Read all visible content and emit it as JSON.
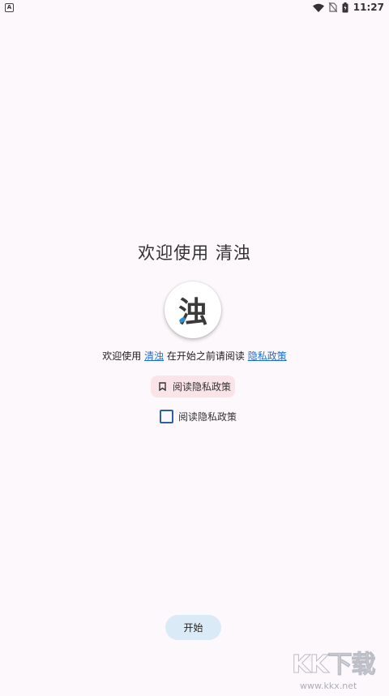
{
  "status_bar": {
    "notification_icon_letter": "A",
    "time": "11:27"
  },
  "welcome": {
    "title": "欢迎使用 清浊",
    "logo_char": "浊",
    "intro_prefix": "欢迎使用 ",
    "app_name_link": "清浊",
    "intro_middle": " 在开始之前请阅读 ",
    "policy_link": "隐私政策"
  },
  "policy_chip": {
    "label": "阅读隐私政策"
  },
  "consent": {
    "label": "阅读隐私政策",
    "checked": false
  },
  "start_button": {
    "label": "开始"
  },
  "watermark": {
    "main": "KK下载",
    "url": "www.kkx.net"
  },
  "colors": {
    "background": "#fdf8fb",
    "link": "#1a6fd1",
    "chip_bg": "#fbe4e8",
    "checkbox_border": "#2f5fa8",
    "button_bg": "#dbeaf7",
    "logo_accent": "#2e8fd6"
  }
}
